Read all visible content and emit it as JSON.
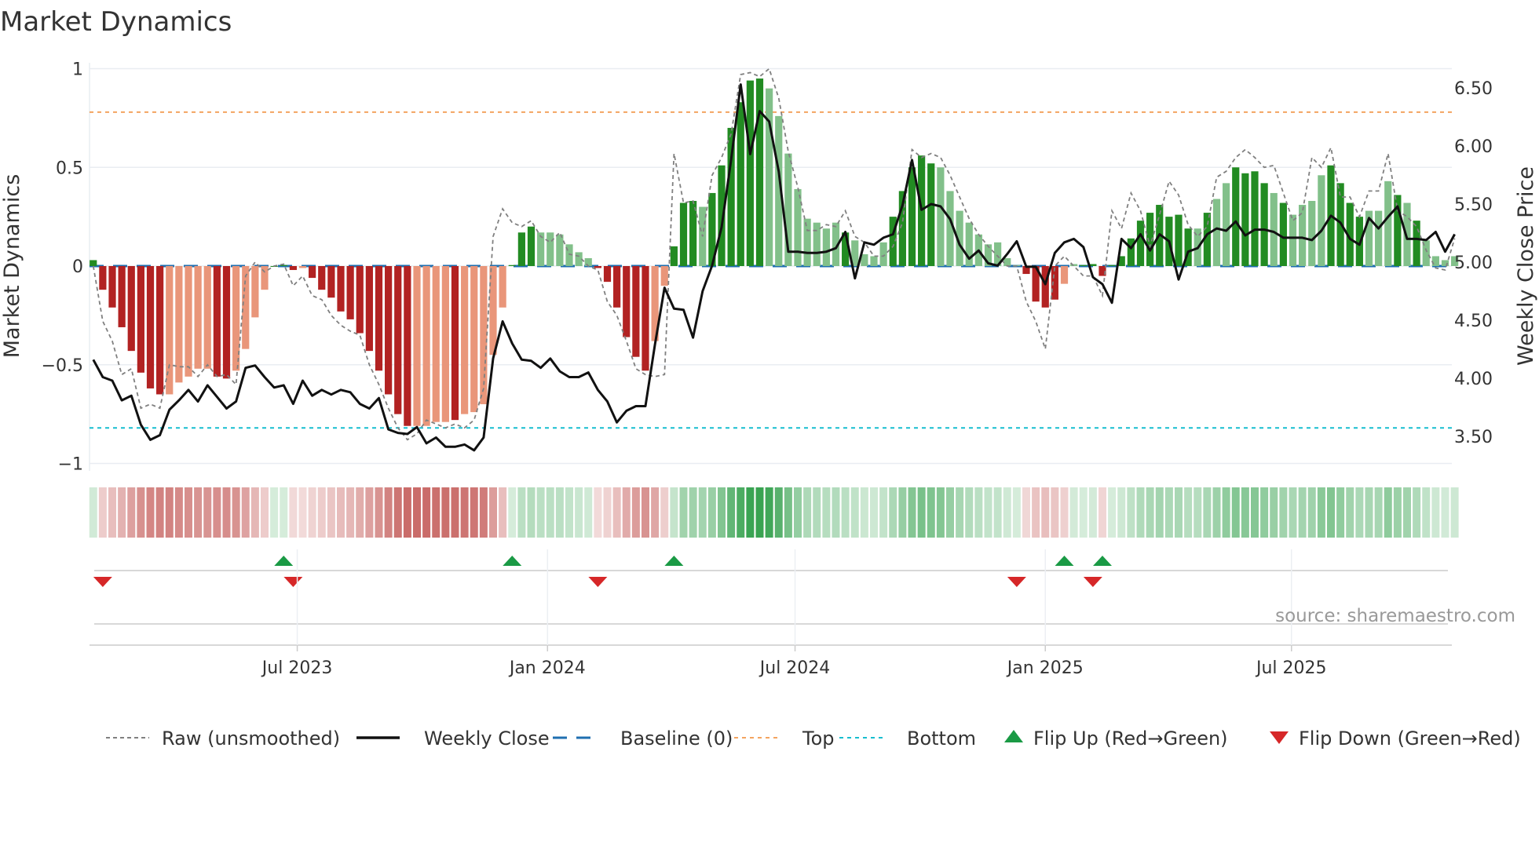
{
  "title": "Market Dynamics",
  "source": "source: sharemaestro.com",
  "chart_data": {
    "type": "bar",
    "title": "Market Dynamics",
    "ylabel": "Market Dynamics",
    "y2label": "Weekly Close Price",
    "ylim": [
      -1.0,
      1.0
    ],
    "y2lim": [
      3.33,
      6.7
    ],
    "yticks": [
      {
        "v": 1,
        "label": "1"
      },
      {
        "v": 0.5,
        "label": "0.5"
      },
      {
        "v": 0,
        "label": "0"
      },
      {
        "v": -0.5,
        "label": "−0.5"
      },
      {
        "v": -1,
        "label": "−1"
      }
    ],
    "y2ticks": [
      {
        "v": 6.5,
        "label": "6.50"
      },
      {
        "v": 6.0,
        "label": "6.00"
      },
      {
        "v": 5.5,
        "label": "5.50"
      },
      {
        "v": 5.0,
        "label": "5.00"
      },
      {
        "v": 4.5,
        "label": "4.50"
      },
      {
        "v": 4.0,
        "label": "4.00"
      },
      {
        "v": 3.5,
        "label": "3.50"
      }
    ],
    "start_date": "2023-02-01",
    "frequency": "weekly",
    "xticks": [
      {
        "date": "2023-07-01",
        "label": "Jul 2023"
      },
      {
        "date": "2024-01-01",
        "label": "Jan 2024"
      },
      {
        "date": "2024-07-01",
        "label": "Jul 2024"
      },
      {
        "date": "2025-01-01",
        "label": "Jan 2025"
      },
      {
        "date": "2025-07-01",
        "label": "Jul 2025"
      }
    ],
    "top_level": 0.78,
    "bottom_level": -0.82,
    "baseline": 0,
    "dynamics": [
      0.03,
      -0.12,
      -0.21,
      -0.31,
      -0.43,
      -0.54,
      -0.62,
      -0.65,
      -0.65,
      -0.59,
      -0.56,
      -0.52,
      -0.52,
      -0.56,
      -0.57,
      -0.53,
      -0.42,
      -0.26,
      -0.12,
      0.0,
      0.005,
      -0.02,
      -0.01,
      -0.06,
      -0.12,
      -0.16,
      -0.23,
      -0.27,
      -0.34,
      -0.43,
      -0.53,
      -0.65,
      -0.75,
      -0.81,
      -0.81,
      -0.81,
      -0.79,
      -0.79,
      -0.78,
      -0.75,
      -0.74,
      -0.7,
      -0.45,
      -0.21,
      0.005,
      0.17,
      0.2,
      0.17,
      0.17,
      0.16,
      0.11,
      0.07,
      0.04,
      -0.01,
      -0.08,
      -0.21,
      -0.36,
      -0.46,
      -0.53,
      -0.38,
      -0.1,
      0.1,
      0.32,
      0.33,
      0.3,
      0.37,
      0.51,
      0.7,
      0.83,
      0.94,
      0.95,
      0.9,
      0.76,
      0.57,
      0.39,
      0.24,
      0.22,
      0.19,
      0.22,
      0.17,
      0.13,
      0.06,
      0.05,
      0.12,
      0.25,
      0.38,
      0.5,
      0.56,
      0.52,
      0.5,
      0.38,
      0.28,
      0.22,
      0.16,
      0.11,
      0.12,
      0.04,
      0.005,
      -0.04,
      -0.18,
      -0.21,
      -0.17,
      -0.09,
      0.01,
      0.005,
      0.01,
      -0.05,
      0.005,
      0.05,
      0.14,
      0.23,
      0.27,
      0.31,
      0.25,
      0.26,
      0.19,
      0.19,
      0.27,
      0.34,
      0.42,
      0.5,
      0.47,
      0.48,
      0.42,
      0.37,
      0.32,
      0.26,
      0.31,
      0.33,
      0.46,
      0.51,
      0.42,
      0.32,
      0.25,
      0.28,
      0.28,
      0.43,
      0.36,
      0.32,
      0.23,
      0.13,
      0.05,
      0.03,
      0.05
    ],
    "strength": "SSSSSSSSWWWWWSSWWWWSSSWSSSSSSSSSSSWWWWSWWWWWSSSWWWWWWSSSSSSWWSSSWSSSSSSWWWWWWWWSWWWWSSSSSWWWWWWWWWSSSSWWSSSSSSSSSSSSWSWWSSSSWSWWWWSSSSWWWSWSWWWWWWS",
    "raw": [
      0.0,
      -0.28,
      -0.38,
      -0.55,
      -0.52,
      -0.72,
      -0.7,
      -0.72,
      -0.5,
      -0.51,
      -0.51,
      -0.56,
      -0.5,
      -0.56,
      -0.55,
      -0.6,
      -0.05,
      0.02,
      -0.03,
      0.0,
      0.01,
      -0.1,
      -0.05,
      -0.15,
      -0.17,
      -0.25,
      -0.3,
      -0.33,
      -0.35,
      -0.5,
      -0.6,
      -0.72,
      -0.82,
      -0.88,
      -0.85,
      -0.78,
      -0.8,
      -0.82,
      -0.8,
      -0.82,
      -0.78,
      -0.62,
      0.15,
      0.29,
      0.22,
      0.2,
      0.23,
      0.15,
      0.12,
      0.17,
      0.06,
      0.05,
      0.0,
      -0.02,
      -0.18,
      -0.25,
      -0.38,
      -0.52,
      -0.55,
      -0.56,
      -0.55,
      0.57,
      0.32,
      0.33,
      0.15,
      0.46,
      0.55,
      0.67,
      0.97,
      0.98,
      0.96,
      1.0,
      0.85,
      0.58,
      0.4,
      0.18,
      0.18,
      0.21,
      0.2,
      0.28,
      0.15,
      0.12,
      0.05,
      0.05,
      0.1,
      0.22,
      0.59,
      0.55,
      0.57,
      0.55,
      0.46,
      0.35,
      0.24,
      0.16,
      0.1,
      0.05,
      0.0,
      0.0,
      -0.18,
      -0.28,
      -0.42,
      0.0,
      0.05,
      0.0,
      -0.05,
      -0.05,
      -0.15,
      0.28,
      0.19,
      0.37,
      0.28,
      0.1,
      0.26,
      0.43,
      0.36,
      0.21,
      0.15,
      0.2,
      0.45,
      0.48,
      0.55,
      0.59,
      0.55,
      0.5,
      0.51,
      0.37,
      0.23,
      0.27,
      0.55,
      0.5,
      0.6,
      0.35,
      0.35,
      0.25,
      0.38,
      0.38,
      0.57,
      0.28,
      0.25,
      0.2,
      0.08,
      -0.01,
      -0.02,
      0.14
    ],
    "weekly_close": [
      4.16,
      4.01,
      3.98,
      3.81,
      3.85,
      3.6,
      3.47,
      3.51,
      3.73,
      3.81,
      3.9,
      3.8,
      3.94,
      3.84,
      3.74,
      3.8,
      4.09,
      4.11,
      4.01,
      3.92,
      3.94,
      3.78,
      3.98,
      3.85,
      3.9,
      3.86,
      3.9,
      3.88,
      3.78,
      3.74,
      3.83,
      3.56,
      3.53,
      3.52,
      3.58,
      3.44,
      3.49,
      3.41,
      3.41,
      3.43,
      3.38,
      3.49,
      4.17,
      4.49,
      4.3,
      4.16,
      4.15,
      4.09,
      4.17,
      4.06,
      4.01,
      4.01,
      4.05,
      3.9,
      3.8,
      3.62,
      3.72,
      3.76,
      3.76,
      4.29,
      4.78,
      4.6,
      4.59,
      4.35,
      4.75,
      4.97,
      5.3,
      5.88,
      6.53,
      5.93,
      6.3,
      6.21,
      5.78,
      5.09,
      5.09,
      5.08,
      5.08,
      5.09,
      5.12,
      5.26,
      4.86,
      5.17,
      5.15,
      5.21,
      5.24,
      5.49,
      5.88,
      5.45,
      5.5,
      5.48,
      5.37,
      5.15,
      5.03,
      5.1,
      4.99,
      4.97,
      5.07,
      5.18,
      4.96,
      4.96,
      4.81,
      5.08,
      5.17,
      5.2,
      5.13,
      4.87,
      4.81,
      4.65,
      5.2,
      5.12,
      5.24,
      5.1,
      5.24,
      5.18,
      4.85,
      5.09,
      5.12,
      5.24,
      5.29,
      5.27,
      5.35,
      5.23,
      5.28,
      5.28,
      5.26,
      5.21,
      5.21,
      5.21,
      5.19,
      5.27,
      5.4,
      5.34,
      5.2,
      5.15,
      5.38,
      5.29,
      5.39,
      5.48,
      5.2,
      5.2,
      5.19,
      5.26,
      5.09,
      5.24
    ],
    "flip_up_weeks": [
      20,
      44,
      61,
      102,
      106
    ],
    "flip_down_weeks": [
      1,
      21,
      53,
      97,
      105
    ],
    "legend": {
      "placement": "bottom",
      "items": [
        {
          "label": "Raw (unsmoothed)",
          "kind": "raw"
        },
        {
          "label": "Weekly Close",
          "kind": "close"
        },
        {
          "label": "Baseline (0)",
          "kind": "baseline"
        },
        {
          "label": "Top",
          "kind": "top"
        },
        {
          "label": "Bottom",
          "kind": "bottom"
        },
        {
          "label": "Flip Up (Red→Green)",
          "kind": "up"
        },
        {
          "label": "Flip Down (Green→Red)",
          "kind": "down"
        }
      ]
    },
    "colors": {
      "strong_green": "#228b22",
      "weak_green": "#82c08a",
      "strong_red": "#b22222",
      "weak_red": "#e9967a",
      "raw": "#808080",
      "close": "#111111",
      "baseline": "#1f6fb0",
      "top": "#f4a460",
      "bottom": "#17becf",
      "flip_up": "#1a9a45",
      "flip_down": "#d62728",
      "grid": "#e9edf2"
    }
  }
}
